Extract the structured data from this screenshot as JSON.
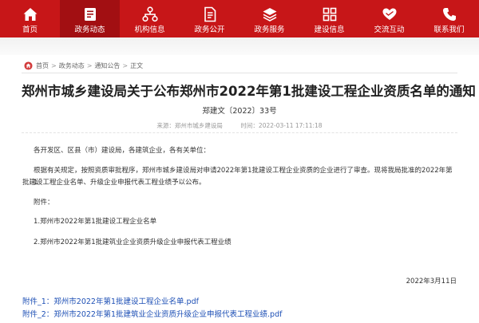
{
  "nav": {
    "items": [
      {
        "label": "首页",
        "icon": "home-icon"
      },
      {
        "label": "政务动态",
        "icon": "book-icon"
      },
      {
        "label": "机构信息",
        "icon": "org-chart-icon"
      },
      {
        "label": "政务公开",
        "icon": "document-icon"
      },
      {
        "label": "政务服务",
        "icon": "layers-icon"
      },
      {
        "label": "建设信息",
        "icon": "grid-icon"
      },
      {
        "label": "交流互动",
        "icon": "handshake-heart-icon"
      },
      {
        "label": "联系我们",
        "icon": "phone-icon"
      }
    ],
    "active_index": 1,
    "color": "#c71618",
    "active_color": "#a20f12"
  },
  "breadcrumb": {
    "items": [
      "首页",
      "政务动态",
      "通知公告",
      "正文"
    ],
    "separator": ">"
  },
  "article": {
    "title": "郑州市城乡建设局关于公布郑州市2022年第1批建设工程企业资质名单的通知",
    "doc_number": "郑建文〔2022〕33号",
    "meta": "来源：郑州市城乡建设局　　　时间：2022-03-11 17:11:18",
    "salutation": "各开发区、区县（市）建设局，各建筑企业，各有关单位：",
    "body_line1": "根据有关规定，按照资质审批程序，郑州市城乡建设局对申请2022年第1批建设工程企业资质的企业进行了审查。现将我局批准的2022年第1",
    "body_line2": "批建设工程企业名单、升级企业申报代表工程业绩予以公布。",
    "attachments_label": "附件：",
    "attachment_item_1": "1.郑州市2022年第1批建设工程企业名单",
    "attachment_item_2": "2.郑州市2022年第1批建筑业企业资质升级企业申报代表工程业绩",
    "date": "2022年3月11日"
  },
  "attachment_links": [
    "附件_1：郑州市2022年第1批建设工程企业名单.pdf",
    "附件_2：郑州市2022年第1批建筑业企业资质升级企业申报代表工程业绩.pdf"
  ],
  "link_color": "#1d4fb5"
}
